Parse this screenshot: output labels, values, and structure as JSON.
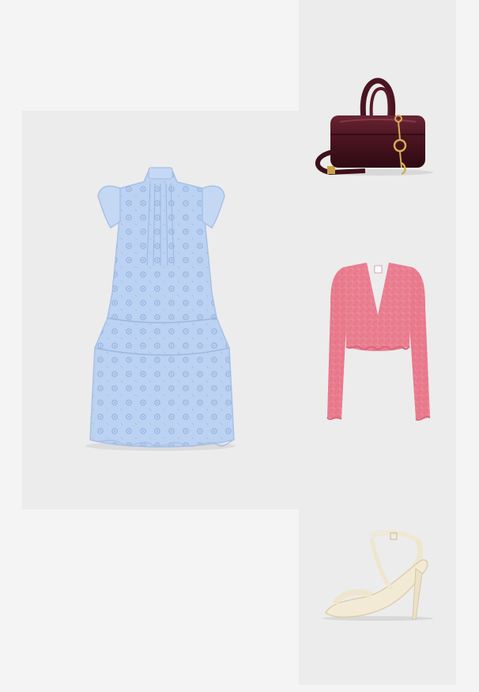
{
  "outfit": {
    "items": [
      {
        "name": "dress",
        "icon": "blue-eyelet-dress-image",
        "color": "#bcd2f2"
      },
      {
        "name": "handbag",
        "icon": "burgundy-handbag-image",
        "color": "#4a1420"
      },
      {
        "name": "cardigan",
        "icon": "pink-crochet-cardigan-image",
        "color": "#e97b8d"
      },
      {
        "name": "sandal",
        "icon": "cream-heeled-sandal-image",
        "color": "#f1e8d4"
      }
    ]
  }
}
